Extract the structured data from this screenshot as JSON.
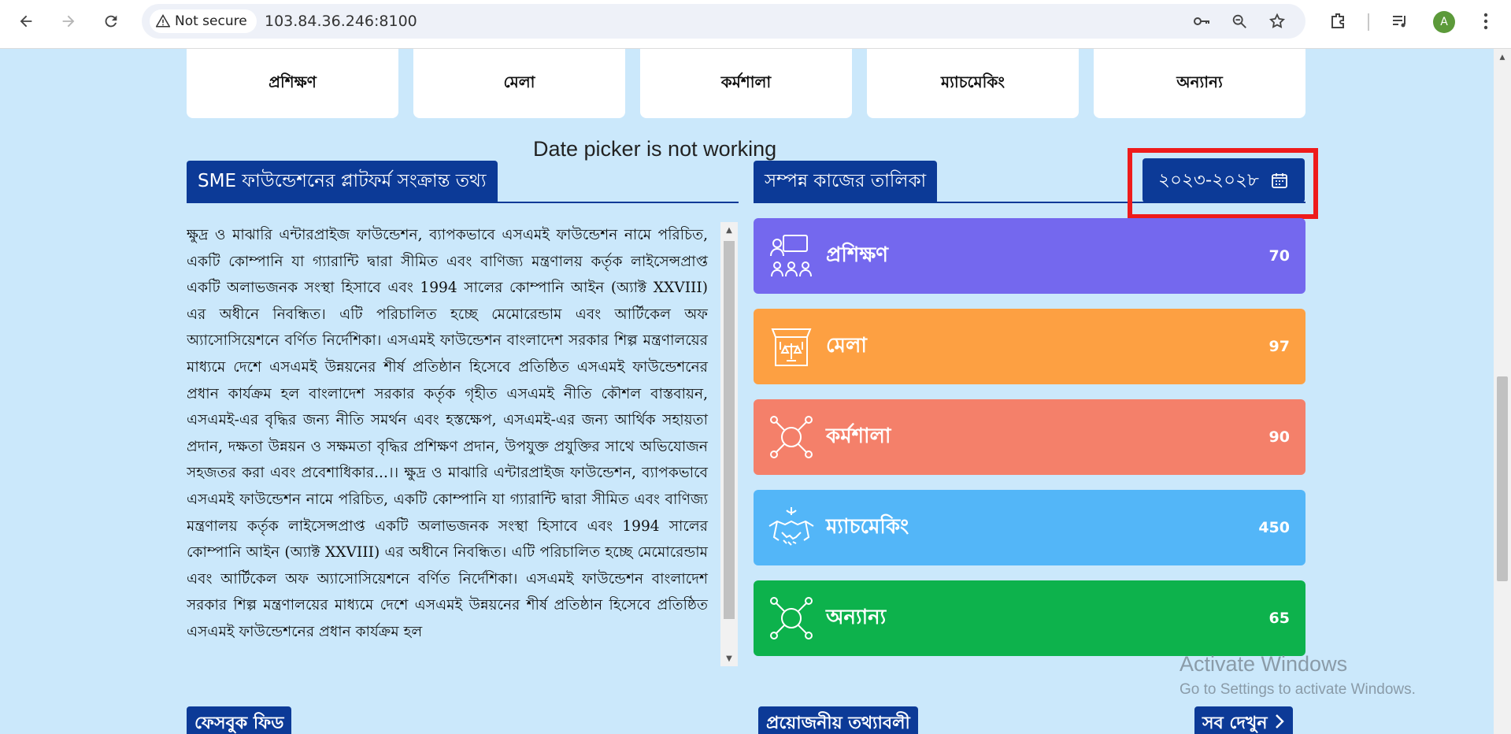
{
  "browser": {
    "security_label": "Not secure",
    "url": "103.84.36.246:8100",
    "avatar_letter": "A"
  },
  "top_categories": [
    "প্রশিক্ষণ",
    "মেলা",
    "কর্মশালা",
    "ম্যাচমেকিং",
    "অন্যান্য"
  ],
  "annotation": "Date picker is not working",
  "info_section": {
    "title": "SME ফাউন্ডেশনের প্লাটফর্ম সংক্রান্ত তথ্য",
    "paragraph": "ক্ষুদ্র ও মাঝারি এন্টারপ্রাইজ ফাউন্ডেশন, ব্যাপকভাবে এসএমই ফাউন্ডেশন নামে পরিচিত, একটি কোম্পানি যা গ্যারান্টি দ্বারা সীমিত এবং বাণিজ্য মন্ত্রণালয় কর্তৃক লাইসেন্সপ্রাপ্ত একটি অলাভজনক সংস্থা হিসাবে এবং 1994 সালের কোম্পানি আইন (অ্যাক্ট XXVIII) এর অধীনে নিবন্ধিত। এটি পরিচালিত হচ্ছে মেমোরেন্ডাম এবং আর্টিকেল অফ অ্যাসোসিয়েশনে বর্ণিত নির্দেশিকা। এসএমই ফাউন্ডেশন বাংলাদেশ সরকার শিল্প মন্ত্রণালয়ের মাধ্যমে দেশে এসএমই উন্নয়নের শীর্ষ প্রতিষ্ঠান হিসেবে প্রতিষ্ঠিত এসএমই ফাউন্ডেশনের প্রধান কার্যক্রম হল বাংলাদেশ সরকার কর্তৃক গৃহীত এসএমই নীতি কৌশল বাস্তবায়ন, এসএমই-এর বৃদ্ধির জন্য নীতি সমর্থন এবং হস্তক্ষেপ, এসএমই-এর জন্য আর্থিক সহায়তা প্রদান, দক্ষতা উন্নয়ন ও সক্ষমতা বৃদ্ধির প্রশিক্ষণ প্রদান, উপযুক্ত প্রযুক্তির সাথে অভিযোজন সহজতর করা এবং প্রবেশাধিকার...।। ক্ষুদ্র ও মাঝারি এন্টারপ্রাইজ ফাউন্ডেশন, ব্যাপকভাবে এসএমই ফাউন্ডেশন নামে পরিচিত, একটি কোম্পানি যা গ্যারান্টি দ্বারা সীমিত এবং বাণিজ্য মন্ত্রণালয় কর্তৃক লাইসেন্সপ্রাপ্ত একটি অলাভজনক সংস্থা হিসাবে এবং 1994 সালের কোম্পানি আইন (অ্যাক্ট XXVIII) এর অধীনে নিবন্ধিত। এটি পরিচালিত হচ্ছে মেমোরেন্ডাম এবং আর্টিকেল অফ অ্যাসোসিয়েশনে বর্ণিত নির্দেশিকা। এসএমই ফাউন্ডেশন বাংলাদেশ সরকার শিল্প মন্ত্রণালয়ের মাধ্যমে দেশে এসএমই উন্নয়নের শীর্ষ প্রতিষ্ঠান হিসেবে প্রতিষ্ঠিত এসএমই ফাউন্ডেশনের প্রধান কার্যক্রম হল"
  },
  "completed_section": {
    "title": "সম্পন্ন কাজের তালিকা",
    "date_range": "২০২৩-২০২৮"
  },
  "stats": [
    {
      "label": "প্রশিক্ষণ",
      "value": "70",
      "color": "#7468ee",
      "icon": "training-icon"
    },
    {
      "label": "মেলা",
      "value": "97",
      "color": "#fda042",
      "icon": "fair-stall-icon"
    },
    {
      "label": "কর্মশালা",
      "value": "90",
      "color": "#f4806a",
      "icon": "workshop-icon"
    },
    {
      "label": "ম্যাচমেকিং",
      "value": "450",
      "color": "#53b6f8",
      "icon": "handshake-icon"
    },
    {
      "label": "অন্যান্য",
      "value": "65",
      "color": "#0db24c",
      "icon": "other-icon"
    }
  ],
  "bottom": {
    "facebook_feed": "ফেসবুক ফিড",
    "necessary_info": "প্রয়োজনীয় তথ্যাবলী",
    "see_all": "সব দেখুন"
  },
  "watermark": {
    "title": "Activate Windows",
    "subtitle": "Go to Settings to activate Windows."
  }
}
